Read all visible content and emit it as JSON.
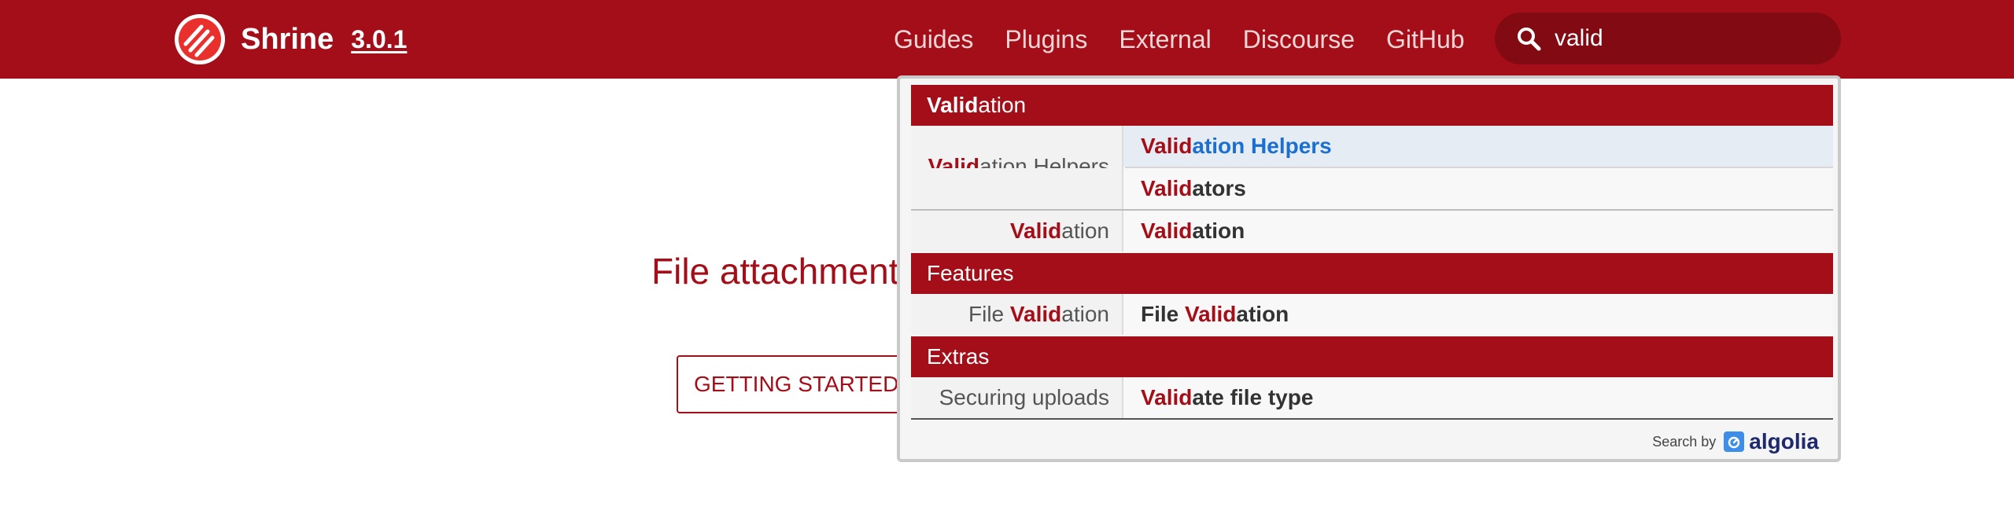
{
  "header": {
    "brand": "Shrine",
    "version": "3.0.1",
    "nav": [
      "Guides",
      "Plugins",
      "External",
      "Discourse",
      "GitHub"
    ]
  },
  "search": {
    "value": "valid"
  },
  "hero": {
    "tagline": "File attachment",
    "button": "GETTING STARTED"
  },
  "dropdown": {
    "sections": [
      {
        "title_hl": "Valid",
        "title_rest": "ation",
        "rows": [
          {
            "left_hl": "Valid",
            "left_rest": "ation Helpers",
            "right_pre": "",
            "right_hl": "Valid",
            "right_rest": "ation Helpers",
            "active": true
          },
          {
            "left_hl": "",
            "left_rest": "",
            "right_pre": "",
            "right_hl": "Valid",
            "right_rest": "ators"
          },
          {
            "left_hl": "Valid",
            "left_rest": "ation",
            "right_pre": "",
            "right_hl": "Valid",
            "right_rest": "ation"
          }
        ]
      },
      {
        "title": "Features",
        "rows": [
          {
            "left_pre": "File ",
            "left_hl": "Valid",
            "left_rest": "ation",
            "right_pre": "File ",
            "right_hl": "Valid",
            "right_rest": "ation"
          }
        ]
      },
      {
        "title": "Extras",
        "rows": [
          {
            "left_plain": "Securing uploads",
            "right_pre": "",
            "right_hl": "Valid",
            "right_rest": "ate file type"
          }
        ]
      }
    ],
    "footer": {
      "search_by": "Search by",
      "provider": "algolia"
    }
  },
  "colors": {
    "brand": "#a30e18",
    "search_bg": "#820a12",
    "active_link": "#1a6fd1"
  }
}
